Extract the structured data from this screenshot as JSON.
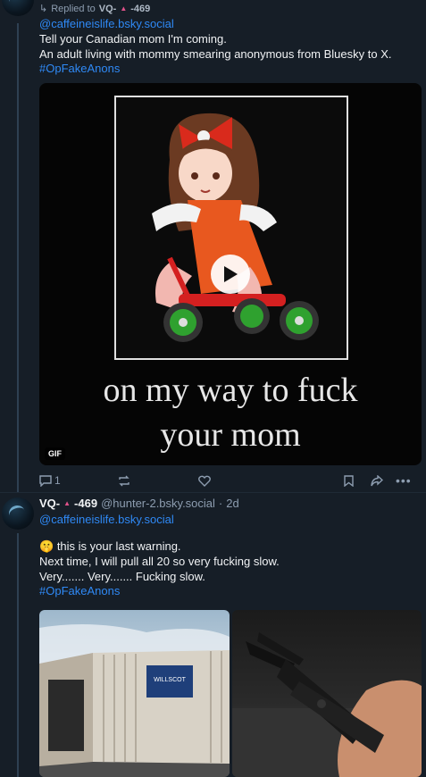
{
  "post1": {
    "replied_to_label": "Replied to",
    "replied_to_name": "VQ-",
    "replied_to_score": "-469",
    "mention": "@caffeineislife.bsky.social",
    "lines": [
      "Tell your Canadian mom I'm coming.",
      "An adult living with mommy smearing anonymous from Bluesky to X."
    ],
    "hashtag": "#OpFakeAnons",
    "gif": {
      "caption_line1": "on my way to fuck",
      "caption_line2": "your mom",
      "badge": "GIF"
    },
    "actions": {
      "reply_count": "1"
    }
  },
  "post2": {
    "author_name": "VQ-",
    "author_score": "-469",
    "handle": "@hunter-2.bsky.social",
    "separator": "·",
    "time": "2d",
    "mention": "@caffeineislife.bsky.social",
    "emoji": "🤫",
    "lines": [
      "this is your last warning.",
      "Next time, I will pull all 20 so very fucking slow.",
      "Very....... Very....... Fucking slow."
    ],
    "hashtag": "#OpFakeAnons",
    "container_sign": "WILLSCOT"
  },
  "colors": {
    "background": "#161e27",
    "link": "#2f89f5",
    "muted": "#8d9db0",
    "score": "#e0528a"
  }
}
